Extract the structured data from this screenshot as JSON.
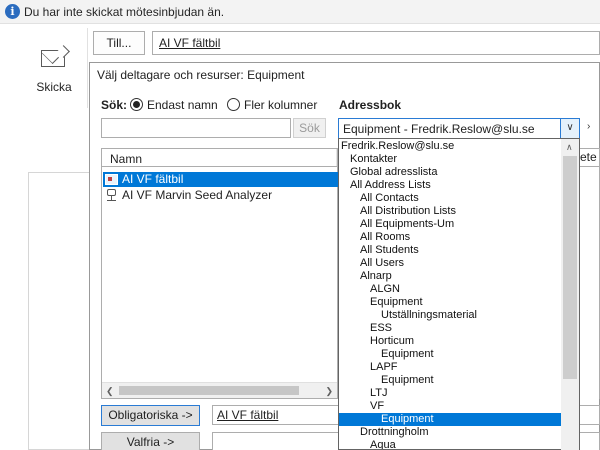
{
  "infobar": {
    "text": "Du har inte skickat mötesinbjudan än."
  },
  "compose": {
    "send_label": "Skicka",
    "to_button": "Till...",
    "to_value": "AI VF fältbil"
  },
  "dialog": {
    "title": "Välj deltagare och resurser: Equipment",
    "search_label": "Sök:",
    "radio_name_label": "Endast namn",
    "radio_more_label": "Fler kolumner",
    "radio_selected": "Endast namn",
    "addressbook_label": "Adressbok",
    "search_value": "",
    "search_button": "Sök",
    "addressbook_value": "Equipment - Fredrik.Reslow@slu.se",
    "column_name": "Namn",
    "column_right_partial": "ete",
    "rows": [
      {
        "label": "AI VF fältbil",
        "selected": true,
        "icon": "resource-car-icon"
      },
      {
        "label": "AI VF Marvin Seed Analyzer",
        "selected": false,
        "icon": "equipment-icon"
      }
    ],
    "required_button": "Obligatoriska ->",
    "required_value": "AI VF fältbil",
    "optional_button": "Valfria ->",
    "optional_value": ""
  },
  "address_books": [
    {
      "label": "Fredrik.Reslow@slu.se",
      "level": 0,
      "selected": false
    },
    {
      "label": "Kontakter",
      "level": 1,
      "selected": false
    },
    {
      "label": "Global adresslista",
      "level": 1,
      "selected": false
    },
    {
      "label": "All Address Lists",
      "level": 1,
      "selected": false
    },
    {
      "label": "All Contacts",
      "level": 2,
      "selected": false
    },
    {
      "label": "All Distribution Lists",
      "level": 2,
      "selected": false
    },
    {
      "label": "All Equipments-Um",
      "level": 2,
      "selected": false
    },
    {
      "label": "All Rooms",
      "level": 2,
      "selected": false
    },
    {
      "label": "All Students",
      "level": 2,
      "selected": false
    },
    {
      "label": "All Users",
      "level": 2,
      "selected": false
    },
    {
      "label": "Alnarp",
      "level": 2,
      "selected": false
    },
    {
      "label": "ALGN",
      "level": 3,
      "selected": false
    },
    {
      "label": "Equipment",
      "level": 3,
      "selected": false
    },
    {
      "label": "Utställningsmaterial",
      "level": 4,
      "selected": false
    },
    {
      "label": "ESS",
      "level": 3,
      "selected": false
    },
    {
      "label": "Horticum",
      "level": 3,
      "selected": false
    },
    {
      "label": "Equipment",
      "level": 4,
      "selected": false
    },
    {
      "label": "LAPF",
      "level": 3,
      "selected": false
    },
    {
      "label": "Equipment",
      "level": 4,
      "selected": false
    },
    {
      "label": "LTJ",
      "level": 3,
      "selected": false
    },
    {
      "label": "VF",
      "level": 3,
      "selected": false
    },
    {
      "label": "Equipment",
      "level": 4,
      "selected": true
    },
    {
      "label": "Drottningholm",
      "level": 2,
      "selected": false
    },
    {
      "label": "Aqua",
      "level": 3,
      "selected": false
    }
  ]
}
